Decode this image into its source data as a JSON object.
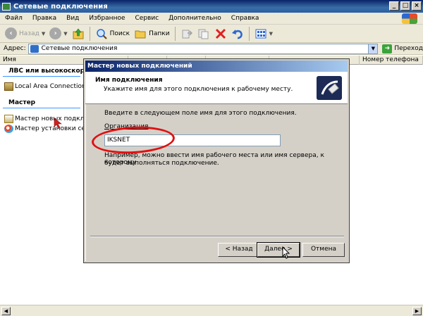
{
  "window": {
    "title": "Сетевые подключения"
  },
  "menu": [
    "Файл",
    "Правка",
    "Вид",
    "Избранное",
    "Сервис",
    "Дополнительно",
    "Справка"
  ],
  "toolbar": {
    "back_label": "Назад",
    "search_label": "Поиск",
    "folders_label": "Папки"
  },
  "address": {
    "label": "Адрес:",
    "value": "Сетевые подключения",
    "go_label": "Переход"
  },
  "columns": [
    "Имя",
    "Номер телефона или а"
  ],
  "groups": [
    {
      "title": "ЛВС или высокоскорост",
      "items": [
        "Local Area Connection"
      ]
    },
    {
      "title": "Мастер",
      "items": [
        "Мастер новых подключен",
        "Мастер установки сети"
      ]
    }
  ],
  "dialog": {
    "title": "Мастер новых подключений",
    "heading": "Имя подключения",
    "subheading": "Укажите имя для этого подключения к рабочему месту.",
    "instruction": "Введите в следующем поле имя для этого подключения.",
    "field_label": "Организация",
    "field_value": "IKSNET",
    "example_line1": "Например, можно ввести имя рабочего места или имя сервера, к которому",
    "example_line2": "будет выполняться подключение.",
    "back_button": "< Назад",
    "next_button": "Далее >",
    "cancel_button": "Отмена"
  },
  "colors": {
    "accent_oval": "#e01010",
    "titlebar": "#0a246a"
  }
}
